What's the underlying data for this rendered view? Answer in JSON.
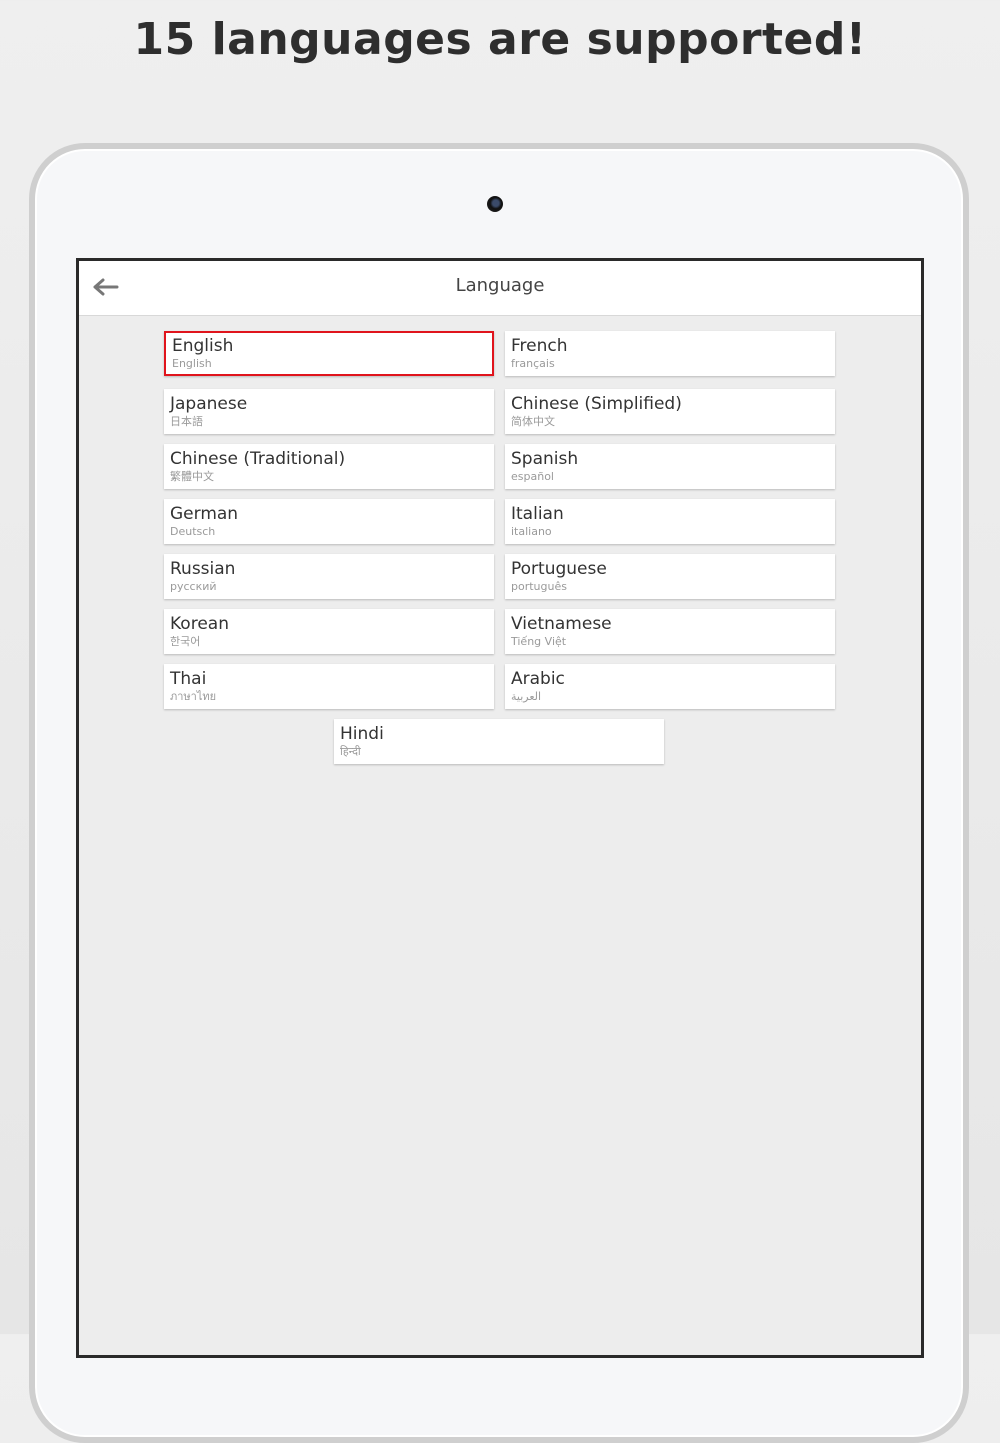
{
  "headline": "15 languages are supported!",
  "app": {
    "title": "Language",
    "back_icon": "arrow-left-icon"
  },
  "languages": [
    {
      "name": "English",
      "native": "English",
      "selected": true
    },
    {
      "name": "French",
      "native": "français"
    },
    {
      "name": "Japanese",
      "native": "日本語"
    },
    {
      "name": "Chinese (Simplified)",
      "native": "简体中文"
    },
    {
      "name": "Chinese (Traditional)",
      "native": "繁體中文"
    },
    {
      "name": "Spanish",
      "native": "español"
    },
    {
      "name": "German",
      "native": "Deutsch"
    },
    {
      "name": "Italian",
      "native": "italiano"
    },
    {
      "name": "Russian",
      "native": "русский"
    },
    {
      "name": "Portuguese",
      "native": "português"
    },
    {
      "name": "Korean",
      "native": "한국어"
    },
    {
      "name": "Vietnamese",
      "native": "Tiếng Việt"
    },
    {
      "name": "Thai",
      "native": "ภาษาไทย"
    },
    {
      "name": "Arabic",
      "native": "العربية"
    },
    {
      "name": "Hindi",
      "native": "हिन्दी"
    }
  ],
  "colors": {
    "selected_border": "#e0141c",
    "screen_background": "#ededed",
    "card_background": "#ffffff"
  }
}
